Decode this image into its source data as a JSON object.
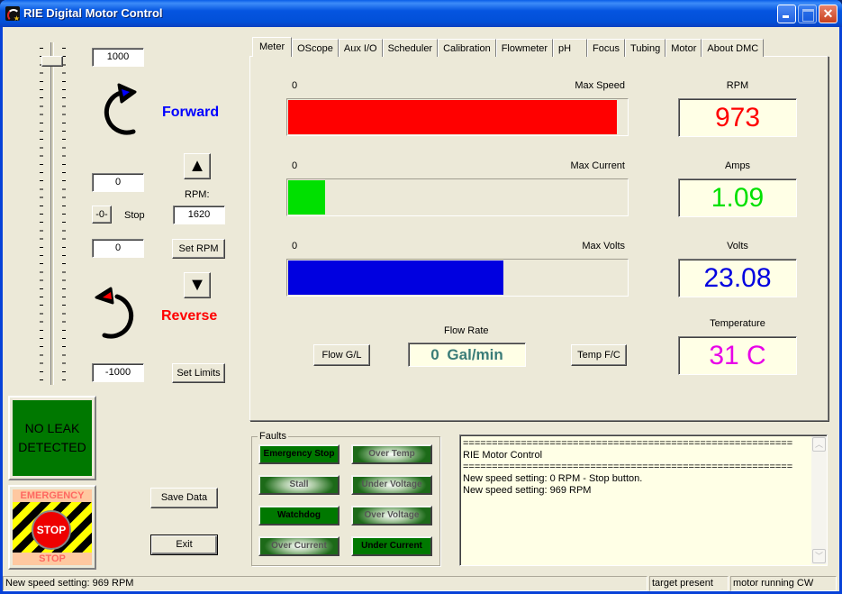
{
  "window": {
    "title": "RIE Digital Motor Control",
    "icon": "rie-app-icon",
    "controls": [
      "minimize",
      "maximize",
      "close"
    ]
  },
  "left": {
    "speed_slider": {
      "value_fraction_from_top": 0.02
    },
    "max_value": "1000",
    "current_value": "0",
    "reverse_value": "0",
    "min_value": "-1000",
    "forward": {
      "label": "Forward",
      "color": "#0000ff",
      "icon": "rotate-clockwise-icon"
    },
    "reverse": {
      "label": "Reverse",
      "color": "#ff0000",
      "icon": "rotate-counterclockwise-icon"
    },
    "up_button": "▲",
    "down_button": "▼",
    "zero_button": "-0-",
    "stop_label": "Stop",
    "rpm_label": "RPM:",
    "rpm_value": "1620",
    "set_rpm_button": "Set RPM",
    "set_limits_button": "Set Limits",
    "leak_status": {
      "line1": "NO LEAK",
      "line2": "DETECTED",
      "color": "#007800"
    },
    "emergency_stop": {
      "top": "EMERGENCY",
      "button": "STOP",
      "bottom": "STOP"
    },
    "save_data_button": "Save Data",
    "exit_button": "Exit"
  },
  "tabs": [
    {
      "label": "Meter",
      "active": true
    },
    {
      "label": "OScope"
    },
    {
      "label": "Aux I/O"
    },
    {
      "label": "Scheduler"
    },
    {
      "label": "Calibration"
    },
    {
      "label": "Flowmeter"
    },
    {
      "label": "pH"
    },
    {
      "label": "Focus"
    },
    {
      "label": "Tubing"
    },
    {
      "label": "Motor"
    },
    {
      "label": "About DMC"
    }
  ],
  "meter": {
    "bars": [
      {
        "min_label": "0",
        "max_label": "Max Speed",
        "fraction": 0.97,
        "color": "#ff0000"
      },
      {
        "min_label": "0",
        "max_label": "Max Current",
        "fraction": 0.11,
        "color": "#00e000"
      },
      {
        "min_label": "0",
        "max_label": "Max Volts",
        "fraction": 0.635,
        "color": "#0000e0"
      }
    ],
    "readouts": [
      {
        "label": "RPM",
        "value": "973",
        "color": "#ff0000"
      },
      {
        "label": "Amps",
        "value": "1.09",
        "color": "#00e000"
      },
      {
        "label": "Volts",
        "value": "23.08",
        "color": "#0000e0"
      },
      {
        "label": "Temperature",
        "value": "31 C",
        "color": "#e800e8"
      }
    ],
    "flow_rate_label": "Flow Rate",
    "flow_rate_value": "0  Gal/min",
    "flow_button": "Flow G/L",
    "temp_button": "Temp F/C"
  },
  "faults": {
    "title": "Faults",
    "items": [
      {
        "label": "Emergency Stop",
        "active": true
      },
      {
        "label": "Over Temp",
        "active": false
      },
      {
        "label": "Stall",
        "active": false
      },
      {
        "label": "Under Voltage",
        "active": false
      },
      {
        "label": "Watchdog",
        "active": true
      },
      {
        "label": "Over Voltage",
        "active": false
      },
      {
        "label": "Over Current",
        "active": false
      },
      {
        "label": "Under Current",
        "active": true
      }
    ]
  },
  "log": {
    "lines": [
      "=========================================================",
      "RIE Motor Control",
      "=========================================================",
      "New speed setting: 0 RPM - Stop button.",
      "New speed setting: 969 RPM"
    ]
  },
  "statusbar": {
    "message": "New speed setting: 969 RPM",
    "target": "target present",
    "motor": "motor running CW"
  }
}
